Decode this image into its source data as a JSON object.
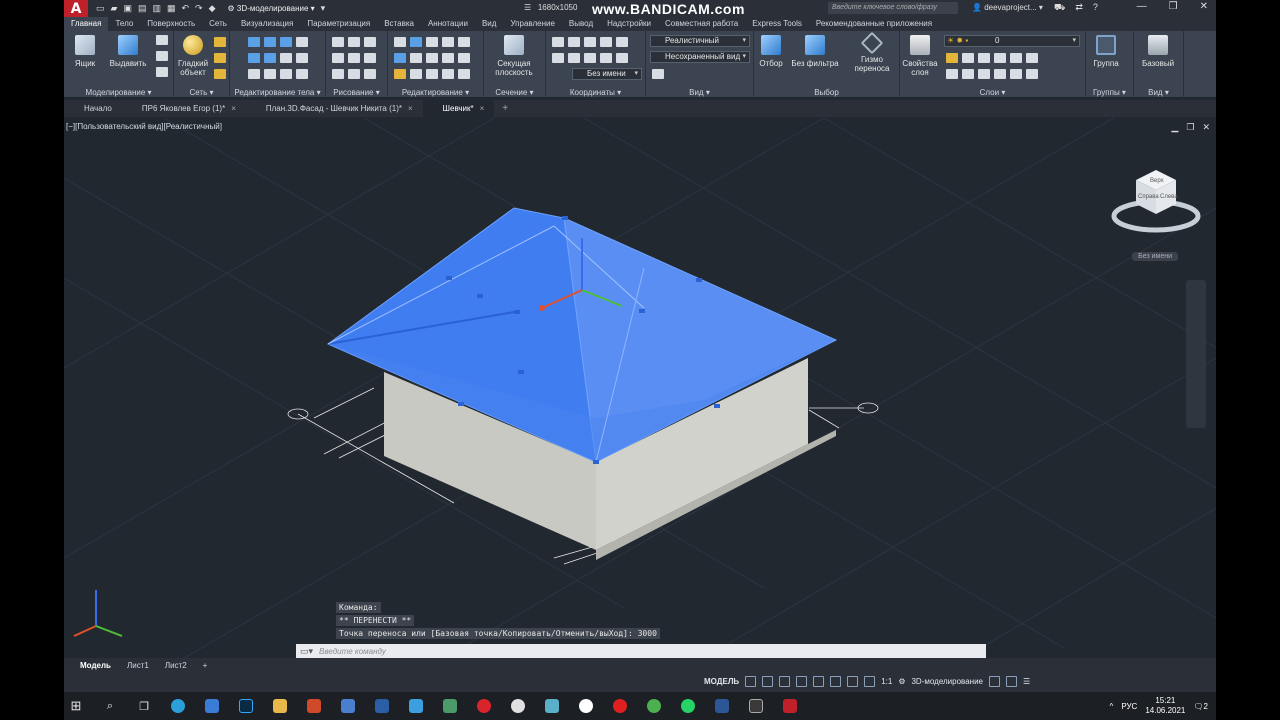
{
  "titlebar": {
    "workspace": "3D-моделирование",
    "doc_resolution": "1680x1050",
    "bandicam": "www.BANDICAM.com",
    "search_placeholder": "Введите ключевое слово/фразу",
    "user": "deevaproject..."
  },
  "tabs": [
    "Главная",
    "Тело",
    "Поверхность",
    "Сеть",
    "Визуализация",
    "Параметризация",
    "Вставка",
    "Аннотации",
    "Вид",
    "Управление",
    "Вывод",
    "Надстройки",
    "Совместная работа",
    "Express Tools",
    "Рекомендованные приложения"
  ],
  "ribbon": {
    "box": "Ящик",
    "extrude": "Выдавить",
    "smooth": "Гладкий",
    "smooth2": "объект",
    "section_plane": "Секущая",
    "section_plane2": "плоскость",
    "visual_style": "Реалистичный",
    "view_combo": "Несохраненный вид",
    "ucs_combo": "Без имени",
    "culling": "Отбор",
    "no_filter": "Без фильтра",
    "gizmo": "Гизмо",
    "gizmo2": "переноса",
    "layer_props": "Свойства",
    "layer_props2": "слоя",
    "layer_value": "0",
    "group": "Группа",
    "base": "Базовый",
    "panels": {
      "modeling": "Моделирование",
      "mesh": "Сеть",
      "solid_edit": "Редактирование тела",
      "draw": "Рисование",
      "modify": "Редактирование",
      "section": "Сечение",
      "coordinates": "Координаты",
      "view": "Вид",
      "selection": "Выбор",
      "layers": "Слои",
      "groups": "Группы",
      "view2": "Вид"
    }
  },
  "filetabs": [
    {
      "label": "Начало",
      "active": false
    },
    {
      "label": "ПР6 Яковлев Егор (1)*",
      "active": false
    },
    {
      "label": "План.3D.Фасад - Шевчик Никита (1)*",
      "active": false
    },
    {
      "label": "Шевчик*",
      "active": true
    }
  ],
  "viewport": {
    "label": "[−][Пользовательский вид][Реалистичный]",
    "named_view": "Без имени",
    "viewcube": {
      "top": "Верх",
      "left": "Справа",
      "right": "Слева"
    }
  },
  "command": {
    "history": [
      "Команда:",
      "** ПЕРЕНЕСТИ **",
      "Точка переноса или [Базовая точка/Копировать/Отменить/выХод]: 3000"
    ],
    "placeholder": "Введите команду"
  },
  "layouts": [
    {
      "label": "Модель",
      "active": true
    },
    {
      "label": "Лист1",
      "active": false
    },
    {
      "label": "Лист2",
      "active": false
    }
  ],
  "status": {
    "model": "МОДЕЛЬ",
    "scale": "1:1",
    "workspace": "3D-моделирование"
  },
  "taskbar": {
    "lang": "РУС",
    "time": "15:21",
    "date": "14.06.2021",
    "notifications": "2"
  },
  "colors": {
    "roof": "#3f7df0",
    "walls": "#c9c9c3",
    "background": "#212830"
  }
}
